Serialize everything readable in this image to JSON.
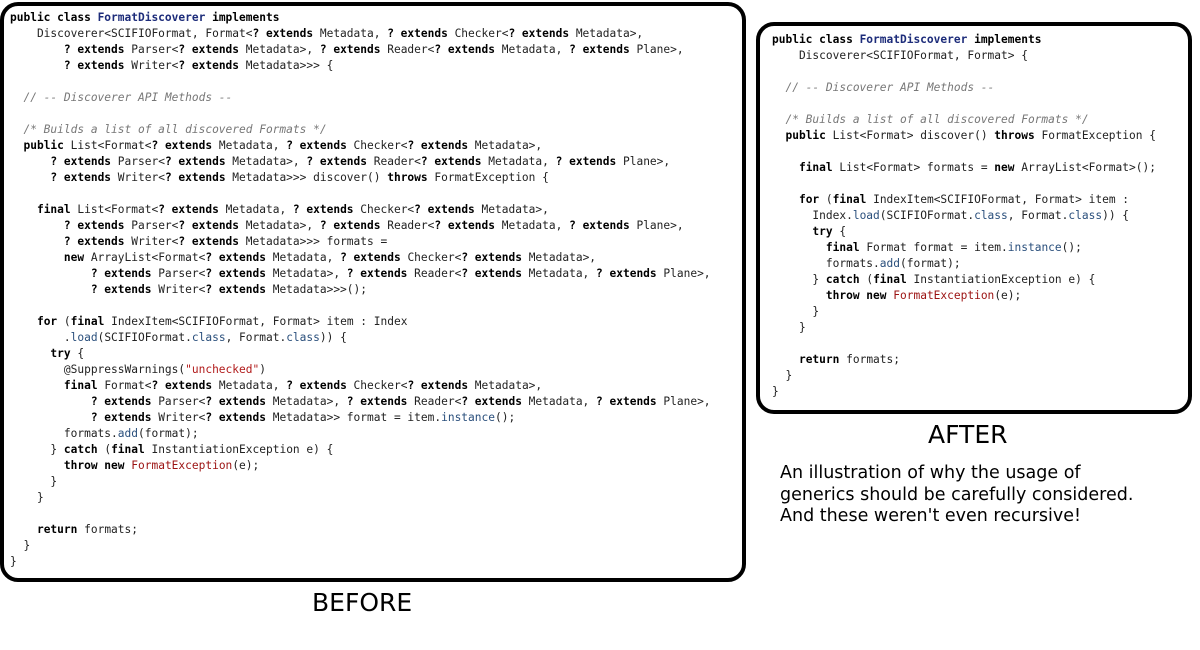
{
  "before": {
    "label": "BEFORE",
    "lines": [
      [
        [
          "public class ",
          "kw"
        ],
        [
          "FormatDiscoverer",
          "cls"
        ],
        [
          " implements",
          "kw"
        ]
      ],
      [
        [
          "    Discoverer<SCIFIOFormat, Format<",
          ""
        ],
        [
          "? extends",
          "kw"
        ],
        [
          " Metadata, ",
          ""
        ],
        [
          "? extends",
          "kw"
        ],
        [
          " Checker<",
          ""
        ],
        [
          "? extends",
          "kw"
        ],
        [
          " Metadata>,",
          ""
        ]
      ],
      [
        [
          "        ",
          ""
        ],
        [
          "? extends",
          "kw"
        ],
        [
          " Parser<",
          ""
        ],
        [
          "? extends",
          "kw"
        ],
        [
          " Metadata>, ",
          ""
        ],
        [
          "? extends",
          "kw"
        ],
        [
          " Reader<",
          ""
        ],
        [
          "? extends",
          "kw"
        ],
        [
          " Metadata, ",
          ""
        ],
        [
          "? extends",
          "kw"
        ],
        [
          " Plane>,",
          ""
        ]
      ],
      [
        [
          "        ",
          ""
        ],
        [
          "? extends",
          "kw"
        ],
        [
          " Writer<",
          ""
        ],
        [
          "? extends",
          "kw"
        ],
        [
          " Metadata>>> {",
          ""
        ]
      ],
      [
        [
          "",
          ""
        ]
      ],
      [
        [
          "  // -- Discoverer API Methods --",
          "cm"
        ]
      ],
      [
        [
          "",
          ""
        ]
      ],
      [
        [
          "  /* Builds a list of all discovered Formats */",
          "cm"
        ]
      ],
      [
        [
          "  ",
          ""
        ],
        [
          "public",
          "kw"
        ],
        [
          " List<Format<",
          ""
        ],
        [
          "? extends",
          "kw"
        ],
        [
          " Metadata, ",
          ""
        ],
        [
          "? extends",
          "kw"
        ],
        [
          " Checker<",
          ""
        ],
        [
          "? extends",
          "kw"
        ],
        [
          " Metadata>,",
          ""
        ]
      ],
      [
        [
          "      ",
          ""
        ],
        [
          "? extends",
          "kw"
        ],
        [
          " Parser<",
          ""
        ],
        [
          "? extends",
          "kw"
        ],
        [
          " Metadata>, ",
          ""
        ],
        [
          "? extends",
          "kw"
        ],
        [
          " Reader<",
          ""
        ],
        [
          "? extends",
          "kw"
        ],
        [
          " Metadata, ",
          ""
        ],
        [
          "? extends",
          "kw"
        ],
        [
          " Plane>,",
          ""
        ]
      ],
      [
        [
          "      ",
          ""
        ],
        [
          "? extends",
          "kw"
        ],
        [
          " Writer<",
          ""
        ],
        [
          "? extends",
          "kw"
        ],
        [
          " Metadata>>> discover() ",
          ""
        ],
        [
          "throws",
          "kw"
        ],
        [
          " FormatException {",
          ""
        ]
      ],
      [
        [
          "",
          ""
        ]
      ],
      [
        [
          "    ",
          ""
        ],
        [
          "final",
          "kw"
        ],
        [
          " List<Format<",
          ""
        ],
        [
          "? extends",
          "kw"
        ],
        [
          " Metadata, ",
          ""
        ],
        [
          "? extends",
          "kw"
        ],
        [
          " Checker<",
          ""
        ],
        [
          "? extends",
          "kw"
        ],
        [
          " Metadata>,",
          ""
        ]
      ],
      [
        [
          "        ",
          ""
        ],
        [
          "? extends",
          "kw"
        ],
        [
          " Parser<",
          ""
        ],
        [
          "? extends",
          "kw"
        ],
        [
          " Metadata>, ",
          ""
        ],
        [
          "? extends",
          "kw"
        ],
        [
          " Reader<",
          ""
        ],
        [
          "? extends",
          "kw"
        ],
        [
          " Metadata, ",
          ""
        ],
        [
          "? extends",
          "kw"
        ],
        [
          " Plane>,",
          ""
        ]
      ],
      [
        [
          "        ",
          ""
        ],
        [
          "? extends",
          "kw"
        ],
        [
          " Writer<",
          ""
        ],
        [
          "? extends",
          "kw"
        ],
        [
          " Metadata>>> formats =",
          ""
        ]
      ],
      [
        [
          "        ",
          ""
        ],
        [
          "new",
          "kw"
        ],
        [
          " ArrayList<Format<",
          ""
        ],
        [
          "? extends",
          "kw"
        ],
        [
          " Metadata, ",
          ""
        ],
        [
          "? extends",
          "kw"
        ],
        [
          " Checker<",
          ""
        ],
        [
          "? extends",
          "kw"
        ],
        [
          " Metadata>,",
          ""
        ]
      ],
      [
        [
          "            ",
          ""
        ],
        [
          "? extends",
          "kw"
        ],
        [
          " Parser<",
          ""
        ],
        [
          "? extends",
          "kw"
        ],
        [
          " Metadata>, ",
          ""
        ],
        [
          "? extends",
          "kw"
        ],
        [
          " Reader<",
          ""
        ],
        [
          "? extends",
          "kw"
        ],
        [
          " Metadata, ",
          ""
        ],
        [
          "? extends",
          "kw"
        ],
        [
          " Plane>,",
          ""
        ]
      ],
      [
        [
          "            ",
          ""
        ],
        [
          "? extends",
          "kw"
        ],
        [
          " Writer<",
          ""
        ],
        [
          "? extends",
          "kw"
        ],
        [
          " Metadata>>>();",
          ""
        ]
      ],
      [
        [
          "",
          ""
        ]
      ],
      [
        [
          "    ",
          ""
        ],
        [
          "for",
          "kw"
        ],
        [
          " (",
          ""
        ],
        [
          "final",
          "kw"
        ],
        [
          " IndexItem<SCIFIOFormat, Format> item : Index",
          ""
        ]
      ],
      [
        [
          "        .",
          ""
        ],
        [
          "load",
          "mt"
        ],
        [
          "(SCIFIOFormat.",
          ""
        ],
        [
          "class",
          "mt"
        ],
        [
          ", Format.",
          ""
        ],
        [
          "class",
          "mt"
        ],
        [
          ")) {",
          ""
        ]
      ],
      [
        [
          "      ",
          ""
        ],
        [
          "try",
          "kw"
        ],
        [
          " {",
          ""
        ]
      ],
      [
        [
          "        @SuppressWarnings(",
          ""
        ],
        [
          "\"unchecked\"",
          "str"
        ],
        [
          ")",
          ""
        ]
      ],
      [
        [
          "        ",
          ""
        ],
        [
          "final",
          "kw"
        ],
        [
          " Format<",
          ""
        ],
        [
          "? extends",
          "kw"
        ],
        [
          " Metadata, ",
          ""
        ],
        [
          "? extends",
          "kw"
        ],
        [
          " Checker<",
          ""
        ],
        [
          "? extends",
          "kw"
        ],
        [
          " Metadata>,",
          ""
        ]
      ],
      [
        [
          "            ",
          ""
        ],
        [
          "? extends",
          "kw"
        ],
        [
          " Parser<",
          ""
        ],
        [
          "? extends",
          "kw"
        ],
        [
          " Metadata>, ",
          ""
        ],
        [
          "? extends",
          "kw"
        ],
        [
          " Reader<",
          ""
        ],
        [
          "? extends",
          "kw"
        ],
        [
          " Metadata, ",
          ""
        ],
        [
          "? extends",
          "kw"
        ],
        [
          " Plane>,",
          ""
        ]
      ],
      [
        [
          "            ",
          ""
        ],
        [
          "? extends",
          "kw"
        ],
        [
          " Writer<",
          ""
        ],
        [
          "? extends",
          "kw"
        ],
        [
          " Metadata>> format = item.",
          ""
        ],
        [
          "instance",
          "mt"
        ],
        [
          "();",
          ""
        ]
      ],
      [
        [
          "        formats.",
          ""
        ],
        [
          "add",
          "mt"
        ],
        [
          "(format);",
          ""
        ]
      ],
      [
        [
          "      } ",
          ""
        ],
        [
          "catch",
          "kw"
        ],
        [
          " (",
          ""
        ],
        [
          "final",
          "kw"
        ],
        [
          " InstantiationException e) {",
          ""
        ]
      ],
      [
        [
          "        ",
          ""
        ],
        [
          "throw new",
          "kw"
        ],
        [
          " ",
          ""
        ],
        [
          "FormatException",
          "red"
        ],
        [
          "(e);",
          ""
        ]
      ],
      [
        [
          "      }",
          ""
        ]
      ],
      [
        [
          "    }",
          ""
        ]
      ],
      [
        [
          "",
          ""
        ]
      ],
      [
        [
          "    ",
          ""
        ],
        [
          "return",
          "kw"
        ],
        [
          " formats;",
          ""
        ]
      ],
      [
        [
          "  }",
          ""
        ]
      ],
      [
        [
          "}",
          ""
        ]
      ]
    ]
  },
  "after": {
    "label": "AFTER",
    "lines": [
      [
        [
          "public class ",
          "kw"
        ],
        [
          "FormatDiscoverer",
          "cls"
        ],
        [
          " implements",
          "kw"
        ]
      ],
      [
        [
          "    Discoverer<SCIFIOFormat, Format> {",
          ""
        ]
      ],
      [
        [
          "",
          ""
        ]
      ],
      [
        [
          "  // -- Discoverer API Methods --",
          "cm"
        ]
      ],
      [
        [
          "",
          ""
        ]
      ],
      [
        [
          "  /* Builds a list of all discovered Formats */",
          "cm"
        ]
      ],
      [
        [
          "  ",
          ""
        ],
        [
          "public",
          "kw"
        ],
        [
          " List<Format> discover() ",
          ""
        ],
        [
          "throws",
          "kw"
        ],
        [
          " FormatException {",
          ""
        ]
      ],
      [
        [
          "",
          ""
        ]
      ],
      [
        [
          "    ",
          ""
        ],
        [
          "final",
          "kw"
        ],
        [
          " List<Format> formats = ",
          ""
        ],
        [
          "new",
          "kw"
        ],
        [
          " ArrayList<Format>();",
          ""
        ]
      ],
      [
        [
          "",
          ""
        ]
      ],
      [
        [
          "    ",
          ""
        ],
        [
          "for",
          "kw"
        ],
        [
          " (",
          ""
        ],
        [
          "final",
          "kw"
        ],
        [
          " IndexItem<SCIFIOFormat, Format> item :",
          ""
        ]
      ],
      [
        [
          "      Index.",
          ""
        ],
        [
          "load",
          "mt"
        ],
        [
          "(SCIFIOFormat.",
          ""
        ],
        [
          "class",
          "mt"
        ],
        [
          ", Format.",
          ""
        ],
        [
          "class",
          "mt"
        ],
        [
          ")) {",
          ""
        ]
      ],
      [
        [
          "      ",
          ""
        ],
        [
          "try",
          "kw"
        ],
        [
          " {",
          ""
        ]
      ],
      [
        [
          "        ",
          ""
        ],
        [
          "final",
          "kw"
        ],
        [
          " Format format = item.",
          ""
        ],
        [
          "instance",
          "mt"
        ],
        [
          "();",
          ""
        ]
      ],
      [
        [
          "        formats.",
          ""
        ],
        [
          "add",
          "mt"
        ],
        [
          "(format);",
          ""
        ]
      ],
      [
        [
          "      } ",
          ""
        ],
        [
          "catch",
          "kw"
        ],
        [
          " (",
          ""
        ],
        [
          "final",
          "kw"
        ],
        [
          " InstantiationException e) {",
          ""
        ]
      ],
      [
        [
          "        ",
          ""
        ],
        [
          "throw new",
          "kw"
        ],
        [
          " ",
          ""
        ],
        [
          "FormatException",
          "red"
        ],
        [
          "(e);",
          ""
        ]
      ],
      [
        [
          "      }",
          ""
        ]
      ],
      [
        [
          "    }",
          ""
        ]
      ],
      [
        [
          "",
          ""
        ]
      ],
      [
        [
          "    ",
          ""
        ],
        [
          "return",
          "kw"
        ],
        [
          " formats;",
          ""
        ]
      ],
      [
        [
          "  }",
          ""
        ]
      ],
      [
        [
          "}",
          ""
        ]
      ]
    ]
  },
  "note": {
    "line1": "An illustration of why the usage of",
    "line2": "generics should be carefully considered.",
    "line3": "And these weren't even recursive!"
  }
}
